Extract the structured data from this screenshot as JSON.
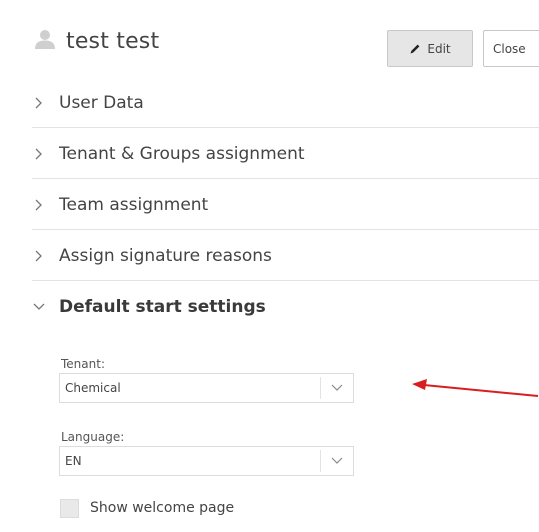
{
  "header": {
    "user_name": "test test",
    "edit_label": "Edit",
    "close_label": "Close"
  },
  "sections": [
    {
      "label": "User Data",
      "expanded": false
    },
    {
      "label": "Tenant & Groups assignment",
      "expanded": false
    },
    {
      "label": "Team assignment",
      "expanded": false
    },
    {
      "label": "Assign signature reasons",
      "expanded": false
    },
    {
      "label": "Default start settings",
      "expanded": true
    }
  ],
  "default_start_settings": {
    "tenant": {
      "label": "Tenant:",
      "value": "Chemical"
    },
    "language": {
      "label": "Language:",
      "value": "EN"
    },
    "show_welcome_page": {
      "label": "Show welcome page",
      "checked": false
    }
  },
  "icons": {
    "user": "user-icon",
    "edit": "pencil-icon",
    "collapsed": "chevron-right-icon",
    "expanded": "chevron-down-icon",
    "dropdown": "chevron-down-icon"
  },
  "colors": {
    "annotation_arrow": "#d81e1e",
    "text": "#444444",
    "edit_button_bg": "#e6e6e6",
    "divider": "#e3e3e3"
  }
}
